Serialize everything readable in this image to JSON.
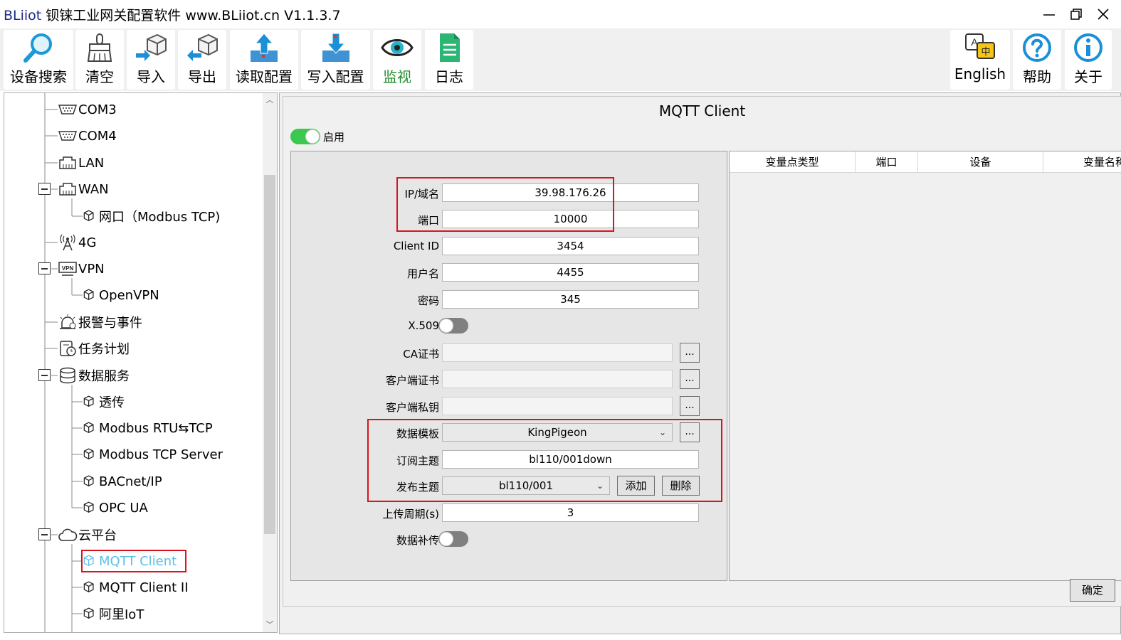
{
  "window": {
    "title_brand": "BLiiot",
    "title_rest": " 钡铼工业网关配置软件 www.BLiiot.cn V1.1.3.7"
  },
  "toolbar": {
    "search": "设备搜索",
    "clear": "清空",
    "import": "导入",
    "export": "导出",
    "read_config": "读取配置",
    "write_config": "写入配置",
    "monitor": "监视",
    "log": "日志",
    "english": "English",
    "help": "帮助",
    "about": "关于",
    "lang_icon_a": "A",
    "lang_icon_zh": "中"
  },
  "tree": {
    "items": [
      {
        "label": "COM3"
      },
      {
        "label": "COM4"
      },
      {
        "label": "LAN"
      },
      {
        "label": "WAN"
      },
      {
        "label": "网口（Modbus TCP)"
      },
      {
        "label": "4G"
      },
      {
        "label": "VPN"
      },
      {
        "label": "OpenVPN"
      },
      {
        "label": "报警与事件"
      },
      {
        "label": "任务计划"
      },
      {
        "label": "数据服务"
      },
      {
        "label": "透传"
      },
      {
        "label": "Modbus RTU⇆TCP"
      },
      {
        "label": "Modbus TCP Server"
      },
      {
        "label": "BACnet/IP"
      },
      {
        "label": "OPC UA"
      },
      {
        "label": "云平台"
      },
      {
        "label": "MQTT Client"
      },
      {
        "label": "MQTT Client II"
      },
      {
        "label": "阿里IoT"
      }
    ],
    "vpn_icon_text": "VPN"
  },
  "panel": {
    "title": "MQTT Client",
    "enable_label": "启用",
    "enable_on": true,
    "ok_button": "确定"
  },
  "form": {
    "host_label": "IP/域名",
    "host_value": "39.98.176.26",
    "port_label": "端口",
    "port_value": "10000",
    "client_id_label": "Client ID",
    "client_id_value": "3454",
    "username_label": "用户名",
    "username_value": "4455",
    "password_label": "密码",
    "password_value": "345",
    "x509_label": "X.509",
    "x509_on": false,
    "ca_label": "CA证书",
    "client_cert_label": "客户端证书",
    "client_key_label": "客户端私钥",
    "dots": "...",
    "template_label": "数据模板",
    "template_value": "KingPigeon",
    "subscribe_label": "订阅主题",
    "subscribe_value": "bl110/001down",
    "publish_label": "发布主题",
    "publish_value": "bl110/001",
    "add_button": "添加",
    "delete_button": "删除",
    "upload_period_label": "上传周期(s)",
    "upload_period_value": "3",
    "resend_label": "数据补传",
    "resend_on": false
  },
  "grid": {
    "columns": [
      "变量点类型",
      "端口",
      "设备",
      "变量名称"
    ]
  },
  "colors": {
    "brand": "#1b2a8f",
    "toggle_on": "#3cc74e",
    "highlight_red": "#d9141e",
    "selected_item": "#5bc0e8",
    "monitor_green": "#1f8a2a"
  }
}
